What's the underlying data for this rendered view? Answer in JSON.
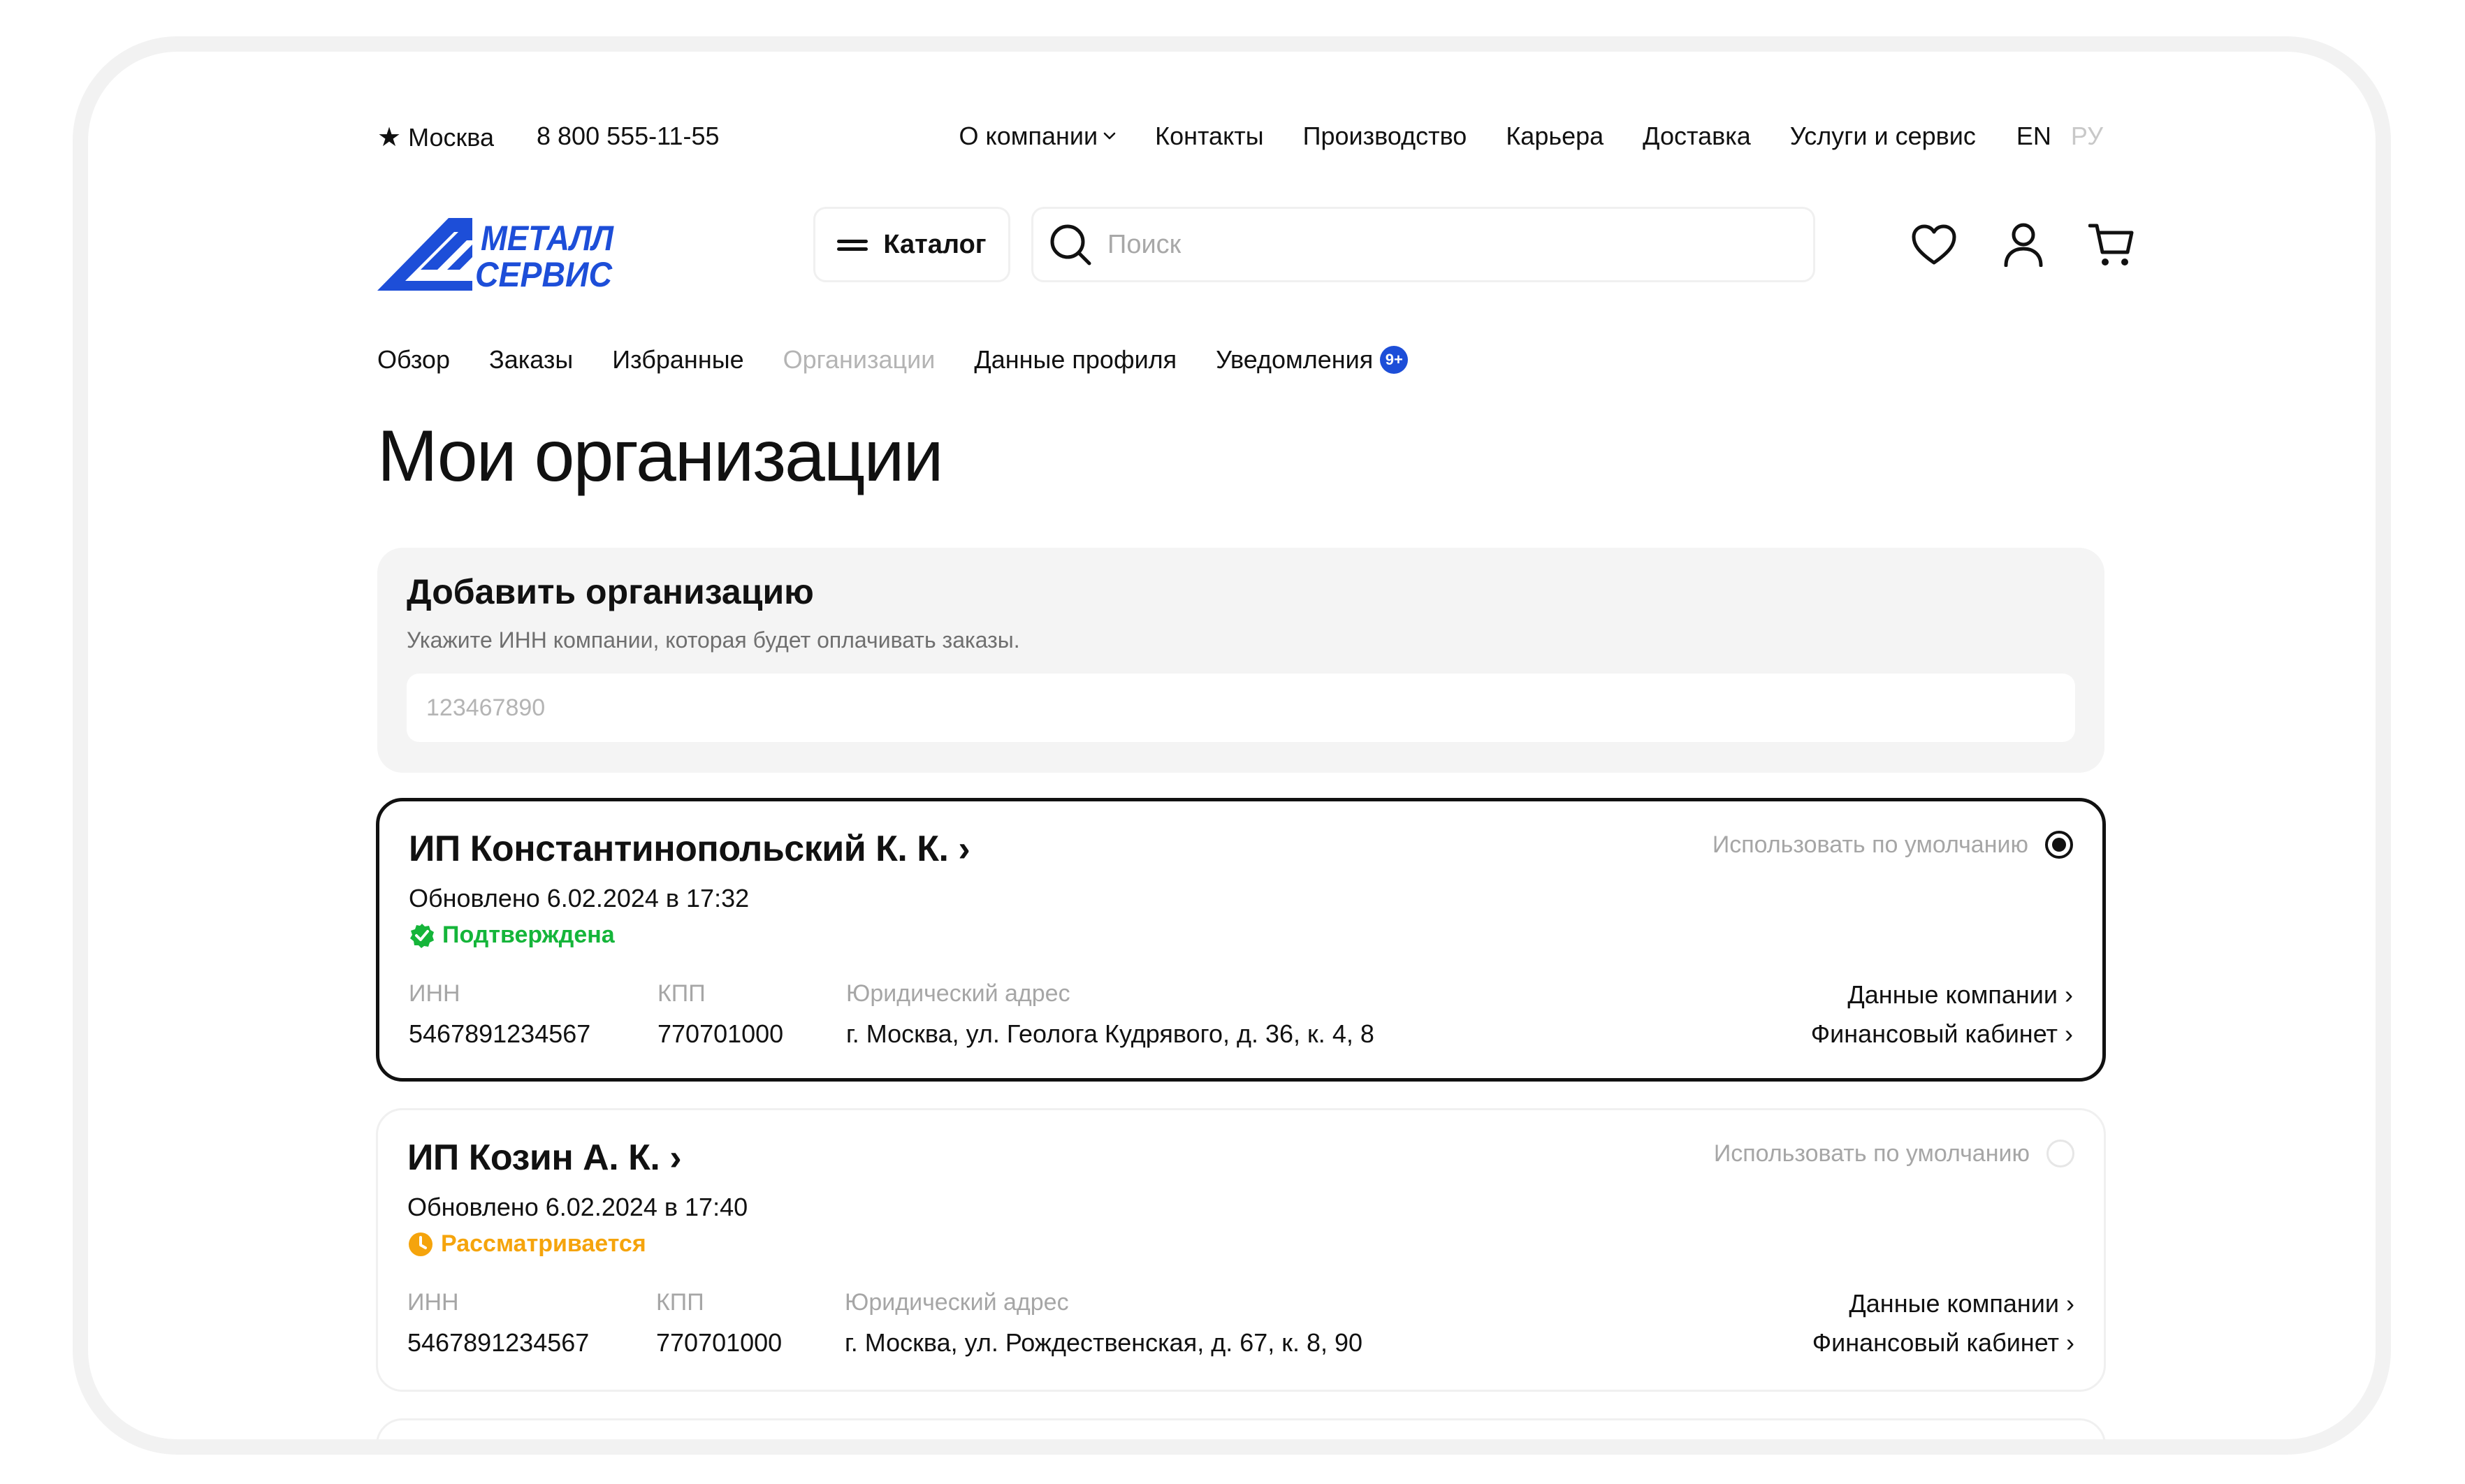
{
  "topbar": {
    "city": "Москва",
    "phone": "8 800 555-11-55",
    "nav": [
      "О компании",
      "Контакты",
      "Производство",
      "Карьера",
      "Доставка",
      "Услуги и сервис"
    ],
    "lang_en": "EN",
    "lang_ru": "РУ"
  },
  "header": {
    "logo_line1": "МЕТАЛЛ",
    "logo_line2": "СЕРВИС",
    "catalog_label": "Каталог",
    "search_placeholder": "Поиск"
  },
  "tabs": {
    "items": [
      "Обзор",
      "Заказы",
      "Избранные",
      "Организации",
      "Данные профиля",
      "Уведомления"
    ],
    "active": "Организации",
    "notifications_badge": "9+"
  },
  "page_title": "Мои организации",
  "add_org": {
    "title": "Добавить организацию",
    "subtitle": "Укажите ИНН компании, которая будет оплачивать заказы.",
    "placeholder": "123467890"
  },
  "labels": {
    "use_default": "Использовать по умолчанию",
    "inn": "ИНН",
    "kpp": "КПП",
    "address": "Юридический адрес",
    "company_data": "Данные компании ›",
    "finance_cabinet": "Финансовый кабинет ›"
  },
  "organizations": [
    {
      "name": "ИП Константинопольский К. К. ›",
      "updated": "Обновлено 6.02.2024 в 17:32",
      "status": "Подтверждена",
      "status_type": "confirmed",
      "is_default": true,
      "inn": "5467891234567",
      "kpp": "770701000",
      "address": "г. Москва, ул. Геолога Кудрявого, д. 36, к. 4, 8"
    },
    {
      "name": "ИП Козин А. К. ›",
      "updated": "Обновлено 6.02.2024 в 17:40",
      "status": "Рассматривается",
      "status_type": "pending",
      "is_default": false,
      "inn": "5467891234567",
      "kpp": "770701000",
      "address": "г. Москва, ул. Рождественская, д. 67, к. 8, 90"
    }
  ],
  "colors": {
    "brand_blue": "#1d4ed8",
    "confirmed_green": "#15b53a",
    "pending_orange": "#f5a40c"
  },
  "icons": [
    "star-icon",
    "chevron-down-icon",
    "menu-icon",
    "search-icon",
    "heart-icon",
    "user-icon",
    "cart-icon",
    "check-badge-icon",
    "clock-icon"
  ]
}
